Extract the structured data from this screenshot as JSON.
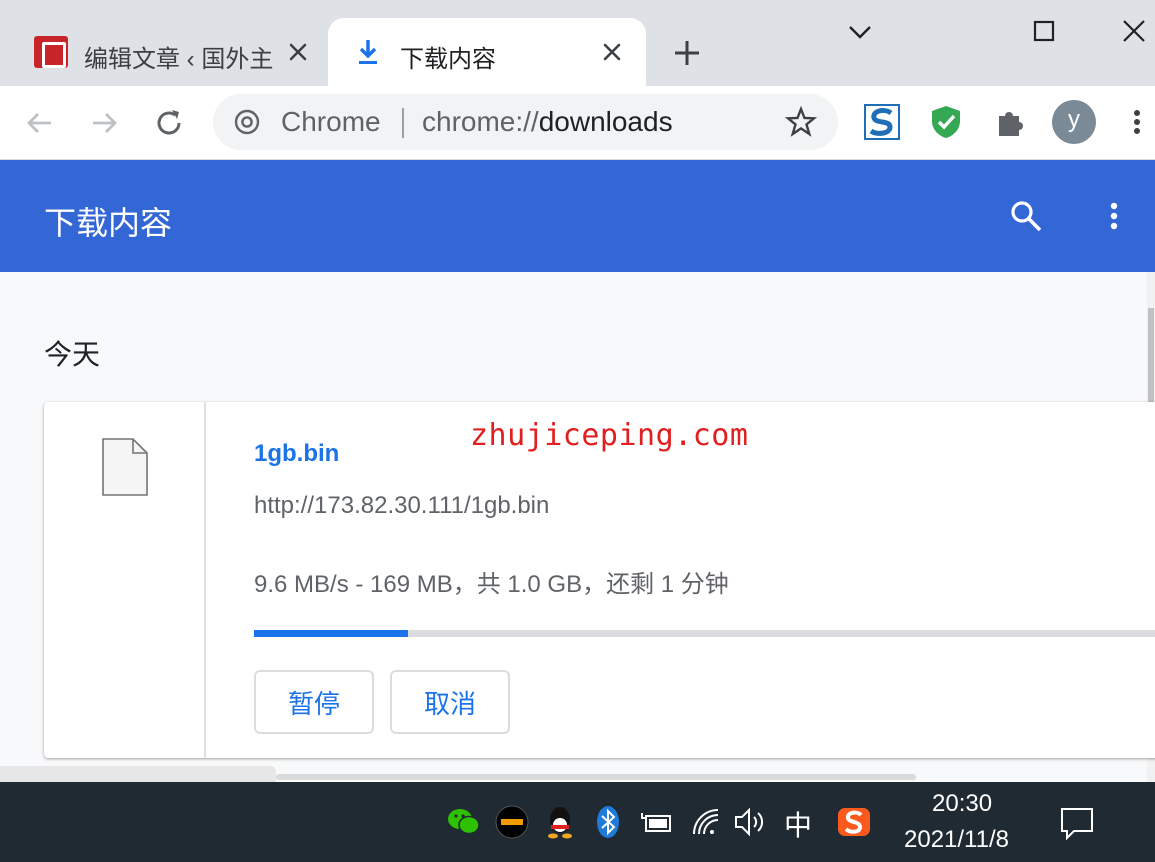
{
  "tabs": [
    {
      "title": "编辑文章 ‹ 国外主",
      "active": false
    },
    {
      "title": "下载内容",
      "active": true
    }
  ],
  "omnibox": {
    "scheme_label": "Chrome",
    "url_prefix": "chrome://",
    "url_path": "downloads"
  },
  "profile": {
    "initial": "y"
  },
  "downloads_page": {
    "title": "下载内容",
    "date_heading": "今天",
    "items": [
      {
        "name": "1gb.bin",
        "url": "http://173.82.30.111/1gb.bin",
        "status": "9.6 MB/s - 169 MB，共 1.0 GB，还剩 1 分钟",
        "progress_fraction": 0.169,
        "pause_label": "暂停",
        "cancel_label": "取消"
      }
    ]
  },
  "watermark": "zhujiceping.com",
  "taskbar": {
    "ime_label": "中",
    "time": "20:30",
    "date": "2021/11/8"
  },
  "colors": {
    "header_blue": "#3367d6",
    "link_blue": "#1a73e8",
    "watermark_red": "#e02020",
    "taskbar": "#1f2a33"
  },
  "icons": [
    "download-icon",
    "close-icon",
    "new-tab-icon",
    "minimize-icon",
    "maximize-icon",
    "window-close-icon",
    "back-icon",
    "forward-icon",
    "reload-icon",
    "chrome-icon",
    "star-icon",
    "extension-s-icon",
    "shield-check-icon",
    "puzzle-icon",
    "more-vert-icon",
    "search-icon",
    "file-icon",
    "wechat-icon",
    "qq-icon",
    "bluetooth-icon",
    "battery-icon",
    "wifi-icon",
    "volume-icon",
    "sogou-icon",
    "notification-icon"
  ]
}
